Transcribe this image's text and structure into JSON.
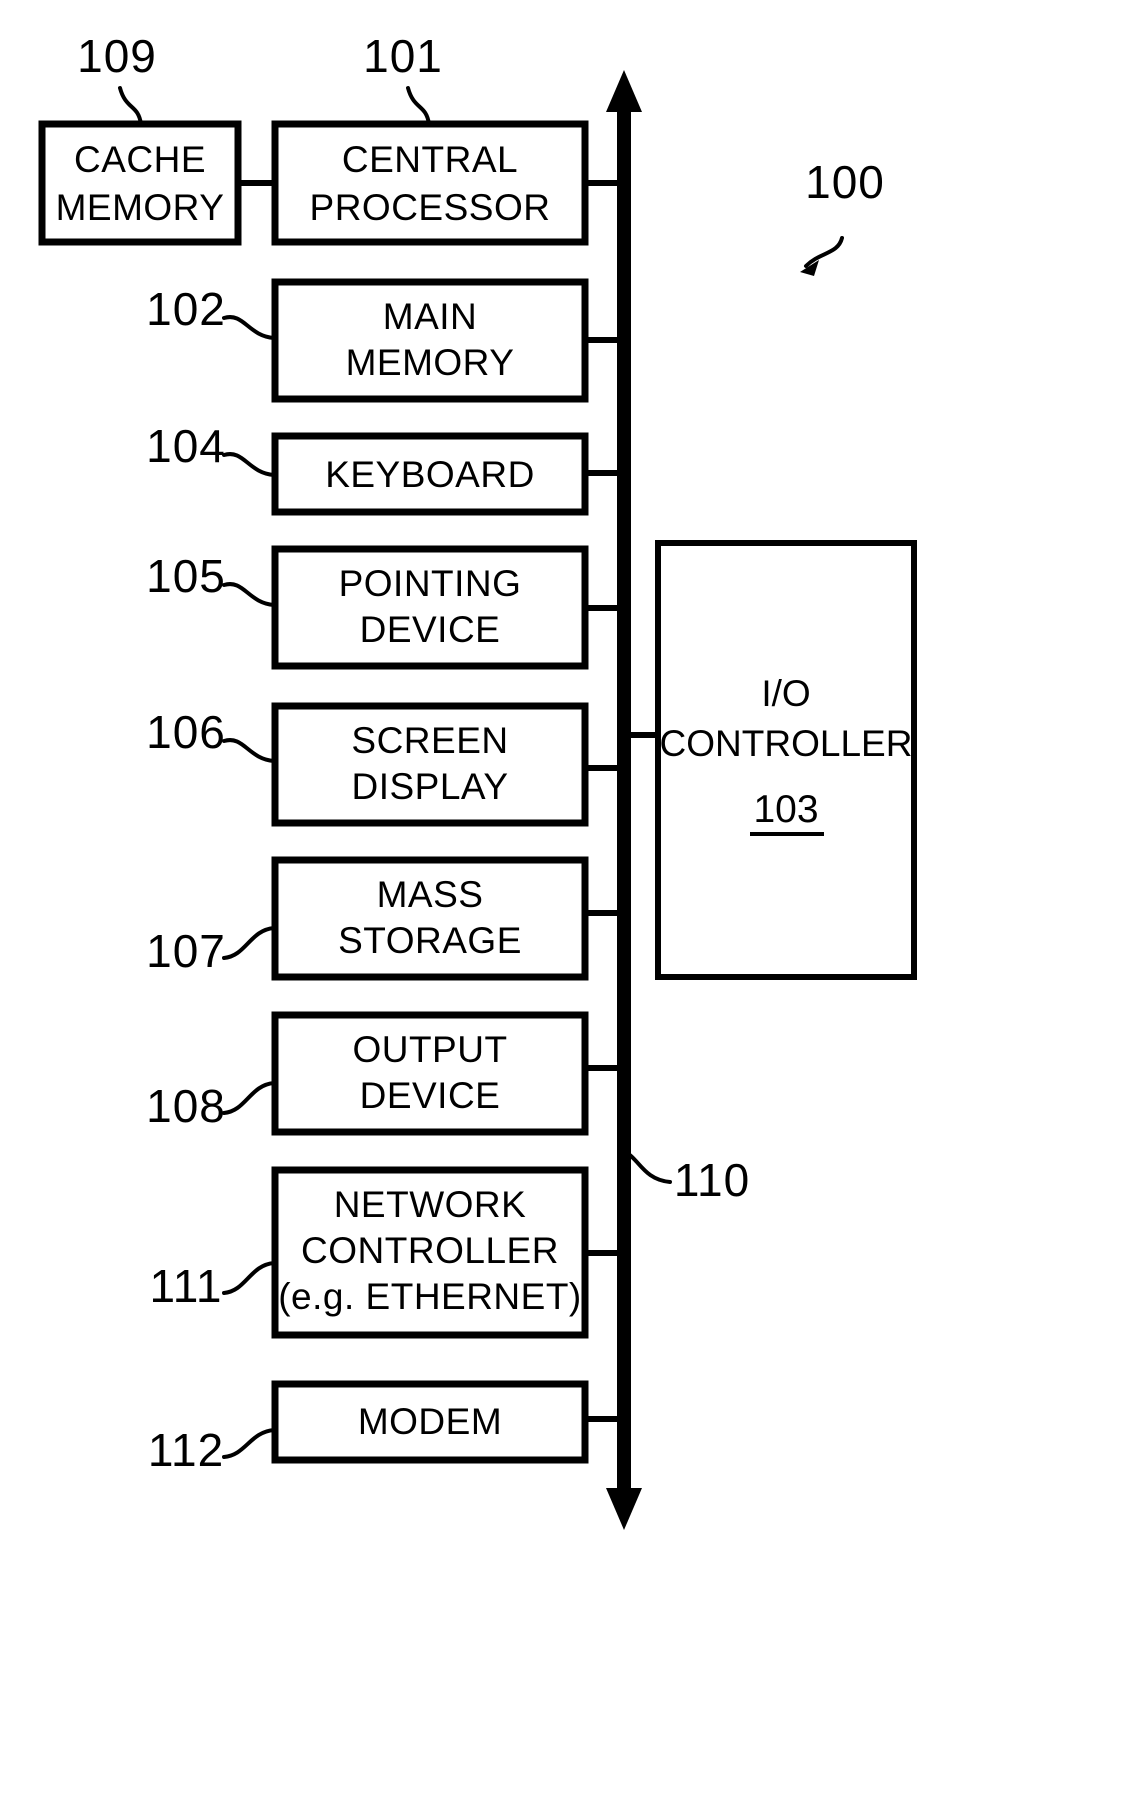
{
  "figure": {
    "title": "Computer system block diagram",
    "system_ref": "100",
    "bus_ref": "110",
    "stroke_color": "#000000",
    "background_color": "#ffffff"
  },
  "blocks": [
    {
      "id": "cache-memory",
      "ref": "109",
      "lines": [
        "CACHE",
        "MEMORY"
      ]
    },
    {
      "id": "central-processor",
      "ref": "101",
      "lines": [
        "CENTRAL",
        "PROCESSOR"
      ]
    },
    {
      "id": "main-memory",
      "ref": "102",
      "lines": [
        "MAIN",
        "MEMORY"
      ]
    },
    {
      "id": "keyboard",
      "ref": "104",
      "lines": [
        "KEYBOARD"
      ]
    },
    {
      "id": "pointing-device",
      "ref": "105",
      "lines": [
        "POINTING",
        "DEVICE"
      ]
    },
    {
      "id": "screen-display",
      "ref": "106",
      "lines": [
        "SCREEN",
        "DISPLAY"
      ]
    },
    {
      "id": "mass-storage",
      "ref": "107",
      "lines": [
        "MASS",
        "STORAGE"
      ]
    },
    {
      "id": "output-device",
      "ref": "108",
      "lines": [
        "OUTPUT",
        "DEVICE"
      ]
    },
    {
      "id": "network-controller",
      "ref": "111",
      "lines": [
        "NETWORK",
        "CONTROLLER",
        "(e.g. ETHERNET)"
      ]
    },
    {
      "id": "modem",
      "ref": "112",
      "lines": [
        "MODEM"
      ]
    }
  ],
  "io_controller": {
    "id": "io-controller",
    "ref": "103",
    "lines": [
      "I/O",
      "CONTROLLER"
    ],
    "ref_underlined": true
  },
  "labels": {
    "ref_109": "109",
    "ref_101": "101",
    "ref_100": "100",
    "ref_102": "102",
    "ref_104": "104",
    "ref_105": "105",
    "ref_106": "106",
    "ref_107": "107",
    "ref_108": "108",
    "ref_110": "110",
    "ref_111": "111",
    "ref_112": "112",
    "cache_line1": "CACHE",
    "cache_line2": "MEMORY",
    "cpu_line1": "CENTRAL",
    "cpu_line2": "PROCESSOR",
    "mainmem_line1": "MAIN",
    "mainmem_line2": "MEMORY",
    "keyboard_line1": "KEYBOARD",
    "pointing_line1": "POINTING",
    "pointing_line2": "DEVICE",
    "screen_line1": "SCREEN",
    "screen_line2": "DISPLAY",
    "mass_line1": "MASS",
    "mass_line2": "STORAGE",
    "output_line1": "OUTPUT",
    "output_line2": "DEVICE",
    "network_line1": "NETWORK",
    "network_line2": "CONTROLLER",
    "network_line3": "(e.g. ETHERNET)",
    "modem_line1": "MODEM",
    "io_line1": "I/O",
    "io_line2": "CONTROLLER",
    "io_ref": "103"
  }
}
